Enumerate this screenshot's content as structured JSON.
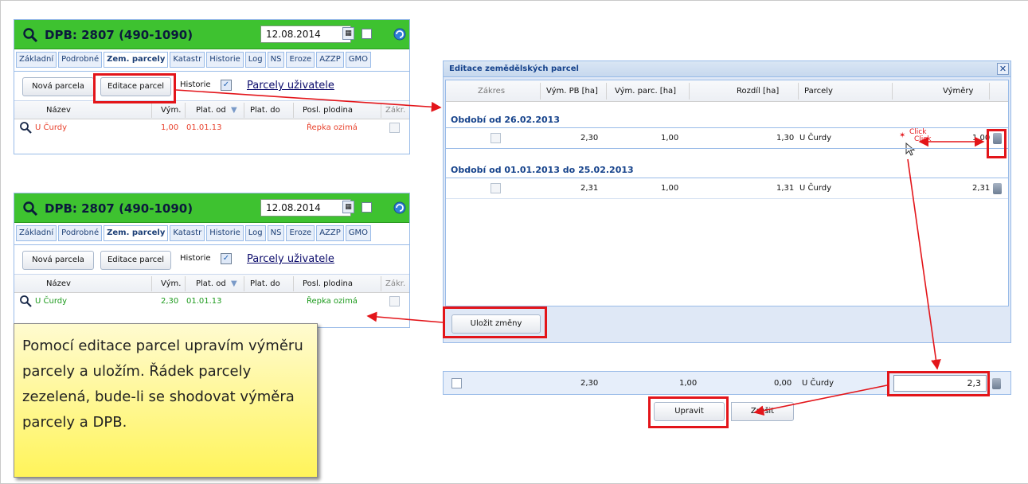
{
  "panel": {
    "title": "DPB: 2807 (490-1090)",
    "date": "12.08.2014",
    "tabs": [
      "Základní",
      "Podrobné",
      "Zem. parcely",
      "Katastr",
      "Historie",
      "Log",
      "NS",
      "Eroze",
      "AZZP",
      "GMO"
    ],
    "active_tab": "Zem. parcely",
    "new_parcel_label": "Nová parcela",
    "edit_parcels_label": "Editace parcel",
    "history_label": "Historie",
    "user_parcels_link": "Parcely uživatele",
    "columns": [
      "Název",
      "Vým.",
      "Plat. od",
      "Plat. do",
      "Posl. plodina",
      "Zákr."
    ]
  },
  "panel_before": {
    "row": {
      "name": "U Čurdy",
      "area": "1,00",
      "valid_from": "01.01.13",
      "valid_to": "",
      "crop": "Řepka ozimá"
    }
  },
  "panel_after": {
    "row": {
      "name": "U Čurdy",
      "area": "2,30",
      "valid_from": "01.01.13",
      "valid_to": "",
      "crop": "Řepka ozimá"
    }
  },
  "dialog": {
    "title": "Editace zemědělských parcel",
    "columns": [
      "Zákres",
      "Vým. PB [ha]",
      "Vým. parc. [ha]",
      "Rozdíl [ha]",
      "Parcely",
      "Výměry"
    ],
    "groups": [
      {
        "label": "Období od 26.02.2013",
        "row": {
          "pb": "2,30",
          "parc": "1,00",
          "diff": "1,30",
          "parcel": "U Čurdy",
          "area": "1,00"
        }
      },
      {
        "label": "Období od 01.01.2013 do 25.02.2013",
        "row": {
          "pb": "2,31",
          "parc": "1,00",
          "diff": "1,31",
          "parcel": "U Čurdy",
          "area": "2,31"
        }
      }
    ],
    "click_label_1": "Click",
    "click_label_2": "Click",
    "save_label": "Uložit změny"
  },
  "edit_row": {
    "pb": "2,30",
    "parc": "1,00",
    "diff": "0,00",
    "parcel": "U Čurdy",
    "area": "2,3",
    "update_label": "Upravit",
    "cancel_label": "Zrušit"
  },
  "note": "Pomocí editace parcel upravím výměru parcely a uložím. Řádek parcely zezelená, bude-li se shodovat výměra parcely a DPB.",
  "colors": {
    "header_green": "#3ec230",
    "highlight_red": "#e3151a",
    "row_red": "#e8412c",
    "row_green": "#1c9a1c",
    "note_yellow": "#fff45a"
  }
}
